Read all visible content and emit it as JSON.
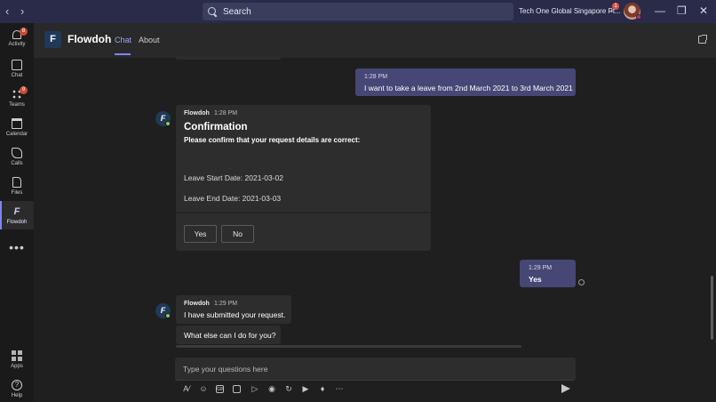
{
  "titlebar": {
    "search_placeholder": "Search",
    "org_name": "Tech One Global Singapore Pt...",
    "org_badge": "1"
  },
  "rail": {
    "items": [
      {
        "label": "Activity",
        "badge": "8"
      },
      {
        "label": "Chat"
      },
      {
        "label": "Teams",
        "badge": "9"
      },
      {
        "label": "Calendar"
      },
      {
        "label": "Calls"
      },
      {
        "label": "Files"
      },
      {
        "label": "Flowdoh"
      },
      {
        "label": "Apps"
      },
      {
        "label": "Help"
      }
    ],
    "more": "•••"
  },
  "header": {
    "logo_letter": "F",
    "app_name": "Flowdoh",
    "tabs": [
      {
        "label": "Chat"
      },
      {
        "label": "About"
      }
    ]
  },
  "messages": {
    "m1": {
      "time": "1:28 PM",
      "text": "I want to take a leave from 2nd March 2021 to 3rd March 2021"
    },
    "card": {
      "sender": "Flowdoh",
      "time": "1:28 PM",
      "title": "Confirmation",
      "subtitle": "Please confirm that your request details are correct:",
      "field1": "Leave Start Date: 2021-03-02",
      "field2": "Leave End Date: 2021-03-03",
      "yes_label": "Yes",
      "no_label": "No"
    },
    "m2": {
      "time": "1:29 PM",
      "text": "Yes"
    },
    "m3": {
      "sender": "Flowdoh",
      "time": "1:29 PM",
      "text": "I have submitted your request."
    },
    "m4": {
      "text": "What else can I do for you?"
    }
  },
  "compose": {
    "placeholder": "Type your questions here"
  },
  "bot_avatar_letter": "F"
}
